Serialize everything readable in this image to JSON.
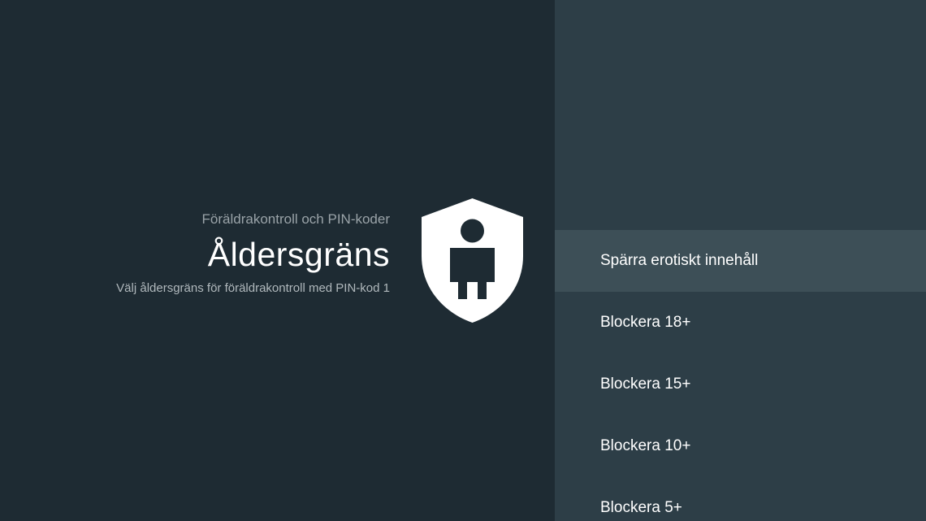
{
  "guidance": {
    "breadcrumb": "Föräldrakontroll och PIN-koder",
    "title": "Åldersgräns",
    "description": "Välj åldersgräns för föräldrakontroll med PIN-kod 1",
    "icon": "shield-person-icon"
  },
  "menu": {
    "selected_index": 0,
    "items": [
      {
        "label": "Spärra erotiskt innehåll"
      },
      {
        "label": "Blockera 18+"
      },
      {
        "label": "Blockera 15+"
      },
      {
        "label": "Blockera 10+"
      },
      {
        "label": "Blockera 5+"
      }
    ]
  },
  "colors": {
    "left_background": "#1e2b33",
    "right_background": "#2d3e47",
    "focused_item": "#3d4f57",
    "text_primary": "#ffffff",
    "text_secondary": "#9aa3a8"
  }
}
